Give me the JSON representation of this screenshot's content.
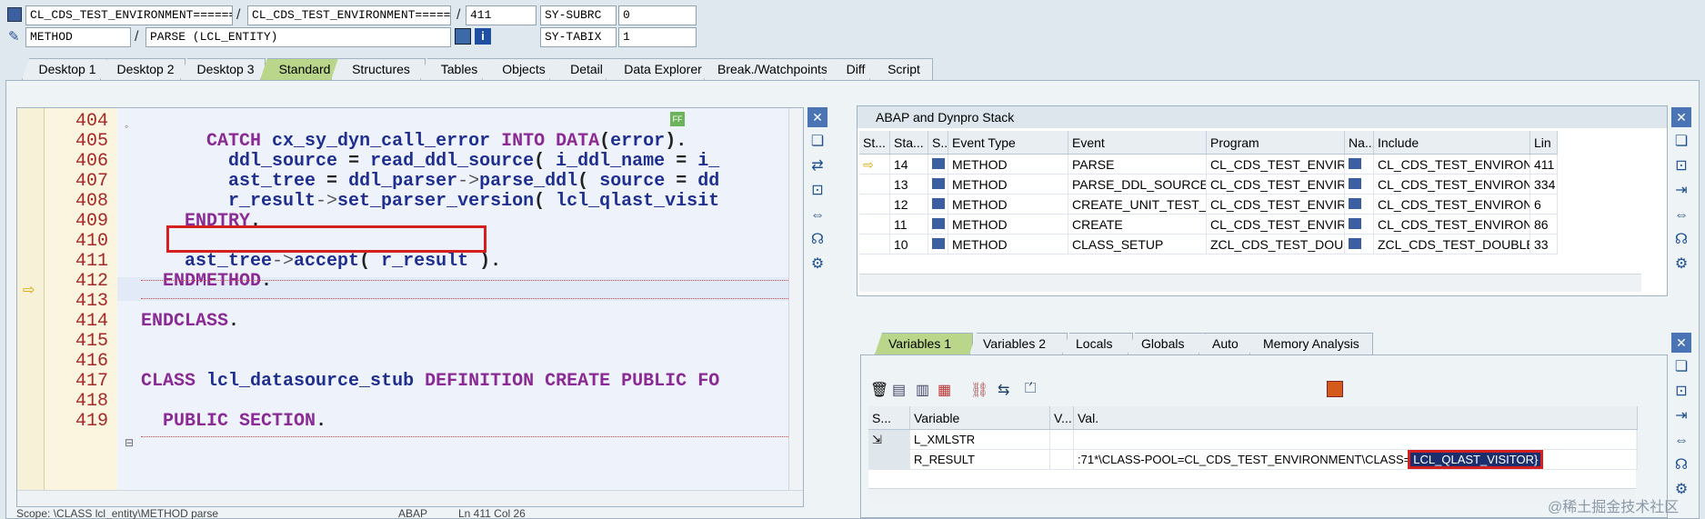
{
  "header": {
    "row1": {
      "class_field": "CL_CDS_TEST_ENVIRONMENT=======",
      "sep1": "/",
      "program_field": "CL_CDS_TEST_ENVIRONMENT=======",
      "sep2": "/",
      "line_field": "411",
      "sysvar_label": "SY-SUBRC",
      "sysvar_value": "0"
    },
    "row2": {
      "type_field": "METHOD",
      "sep": "/",
      "method_field": "PARSE (LCL_ENTITY)",
      "sysvar_label": "SY-TABIX",
      "sysvar_value": "1"
    }
  },
  "tabs": [
    "Desktop 1",
    "Desktop 2",
    "Desktop 3",
    "Standard",
    "Structures",
    "Tables",
    "Objects",
    "Detail",
    "Data Explorer",
    "Break./Watchpoints",
    "Diff",
    "Script"
  ],
  "active_tab": "Standard",
  "editor": {
    "lines": [
      {
        "n": "404",
        "text": ""
      },
      {
        "n": "405",
        "text": "      CATCH cx_sy_dyn_call_error INTO DATA(error)."
      },
      {
        "n": "406",
        "text": "        ddl_source = read_ddl_source( i_ddl_name = i_"
      },
      {
        "n": "407",
        "text": "        ast_tree = ddl_parser->parse_ddl( source = dd"
      },
      {
        "n": "408",
        "text": "        r_result->set_parser_version( lcl_qlast_visit"
      },
      {
        "n": "409",
        "text": "    ENDTRY."
      },
      {
        "n": "410",
        "text": ""
      },
      {
        "n": "411",
        "text": "    ast_tree->accept( r_result )."
      },
      {
        "n": "412",
        "text": "  ENDMETHOD."
      },
      {
        "n": "413",
        "text": ""
      },
      {
        "n": "414",
        "text": "ENDCLASS."
      },
      {
        "n": "415",
        "text": ""
      },
      {
        "n": "416",
        "text": ""
      },
      {
        "n": "417",
        "text": "CLASS lcl_datasource_stub DEFINITION CREATE PUBLIC FO"
      },
      {
        "n": "418",
        "text": ""
      },
      {
        "n": "419",
        "text": "  PUBLIC SECTION."
      }
    ],
    "status": "Scope: \\CLASS lcl_entity\\METHOD parse",
    "lang": "ABAP",
    "position": "Ln 411 Col 26"
  },
  "stack": {
    "title": "ABAP and Dynpro Stack",
    "columns": [
      "St...",
      "Sta...",
      "S...",
      "Event Type",
      "Event",
      "Program",
      "Na...",
      "Include",
      "Lin"
    ],
    "rows": [
      {
        "level": "14",
        "type": "METHOD",
        "event": "PARSE",
        "program": "CL_CDS_TEST_ENVIRON...",
        "include": "CL_CDS_TEST_ENVIRON...",
        "line": "411"
      },
      {
        "level": "13",
        "type": "METHOD",
        "event": "PARSE_DDL_SOURCE",
        "program": "CL_CDS_TEST_ENVIRON...",
        "include": "CL_CDS_TEST_ENVIRON...",
        "line": "334"
      },
      {
        "level": "12",
        "type": "METHOD",
        "event": "CREATE_UNIT_TEST_D...",
        "program": "CL_CDS_TEST_ENVIRON...",
        "include": "CL_CDS_TEST_ENVIRON...",
        "line": "6"
      },
      {
        "level": "11",
        "type": "METHOD",
        "event": "CREATE",
        "program": "CL_CDS_TEST_ENVIRON...",
        "include": "CL_CDS_TEST_ENVIRON...",
        "line": "86"
      },
      {
        "level": "10",
        "type": "METHOD",
        "event": "CLASS_SETUP",
        "program": "ZCL_CDS_TEST_DOUBLE...",
        "include": "ZCL_CDS_TEST_DOUBLE...",
        "line": "33"
      }
    ]
  },
  "vars": {
    "tabs": [
      "Variables 1",
      "Variables 2",
      "Locals",
      "Globals",
      "Auto",
      "Memory Analysis"
    ],
    "active_tab": "Variables 1",
    "columns": [
      "S...",
      "Variable",
      "V...",
      "Val."
    ],
    "rows": [
      {
        "name": "L_XMLSTR",
        "value": ""
      },
      {
        "name": "R_RESULT",
        "value": ":71*\\CLASS-POOL=CL_CDS_TEST_ENVIRONMENT\\CLASS=",
        "highlight": "LCL_QLAST_VISITOR}"
      }
    ]
  },
  "watermark": "@稀土掘金技术社区",
  "colors": {
    "active_tab": "#b9d68a",
    "highlight_box": "#d62020",
    "keyword": "#8a2a94",
    "identifier": "#1f2f8f"
  }
}
